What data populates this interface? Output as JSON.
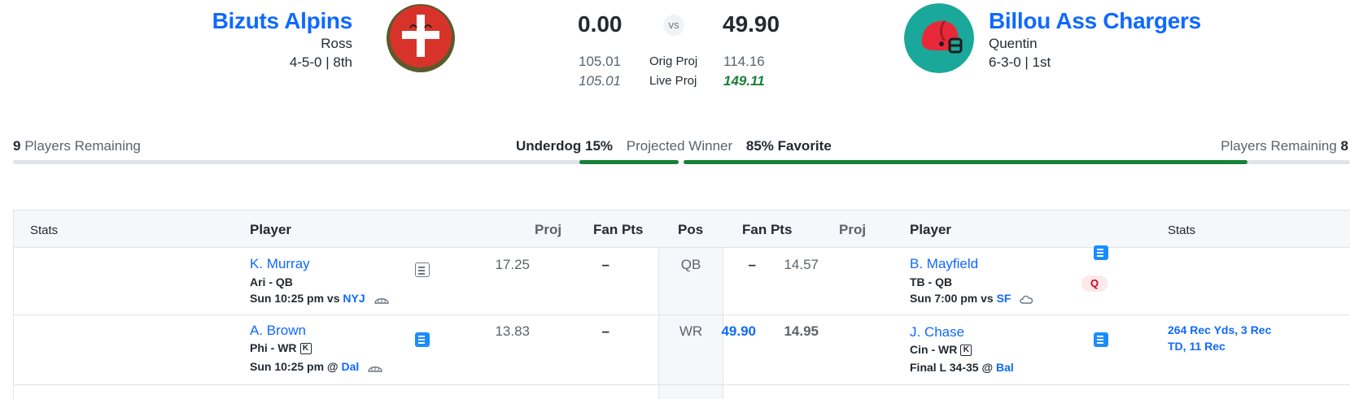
{
  "left_team": {
    "name": "Bizuts Alpins",
    "manager": "Ross",
    "record": "4-5-0 | 8th",
    "logo_icon": "swiss-flag-ball-icon",
    "score": "0.00",
    "orig_proj": "105.01",
    "live_proj": "105.01",
    "players_remaining_count": "9",
    "players_remaining_label": "Players Remaining"
  },
  "right_team": {
    "name": "Billou Ass Chargers",
    "manager": "Quentin",
    "record": "6-3-0 | 1st",
    "logo_icon": "football-helmet-icon",
    "score": "49.90",
    "orig_proj": "114.16",
    "live_proj": "149.11",
    "players_remaining_count": "8",
    "players_remaining_label": "Players Remaining"
  },
  "matchup": {
    "vs": "vs",
    "orig_proj_label": "Orig Proj",
    "live_proj_label": "Live Proj",
    "underdog_label": "Underdog 15%",
    "projected_winner_label": "Projected Winner",
    "favorite_label": "85% Favorite",
    "win_probability_left": 0.15,
    "win_probability_right": 0.85
  },
  "table": {
    "headers": {
      "stats_left": "Stats",
      "player_left": "Player",
      "proj_left": "Proj",
      "fanpts_left": "Fan Pts",
      "pos": "Pos",
      "fanpts_right": "Fan Pts",
      "proj_right": "Proj",
      "player_right": "Player",
      "stats_right": "Stats"
    },
    "rows": [
      {
        "pos": "QB",
        "left": {
          "name": "K. Murray",
          "team_pos": "Ari - QB",
          "game_prefix": "Sun 10:25 pm vs",
          "opponent": "NYJ",
          "weather_icon": "stadium-dome-icon",
          "note_icon": "notes-outline-icon",
          "proj": "17.25",
          "fan_pts": "–",
          "stats": ""
        },
        "right": {
          "name": "B. Mayfield",
          "team_pos": "TB - QB",
          "game_prefix": "Sun 7:00 pm vs",
          "opponent": "SF",
          "weather_icon": "cloud-icon",
          "note_icon": "notes-filled-icon",
          "status_badge": "Q",
          "proj": "14.57",
          "fan_pts": "–",
          "stats": ""
        }
      },
      {
        "pos": "WR",
        "left": {
          "name": "A. Brown",
          "team_pos": "Phi - WR",
          "badge": "K",
          "game_prefix": "Sun 10:25 pm @",
          "opponent": "Dal",
          "weather_icon": "stadium-dome-icon",
          "note_icon": "notes-filled-icon",
          "proj": "13.83",
          "fan_pts": "–",
          "stats": ""
        },
        "right": {
          "name": "J. Chase",
          "team_pos": "Cin - WR",
          "badge": "K",
          "game_prefix": "Final L 34-35 @",
          "opponent": "Bal",
          "note_icon": "notes-filled-icon",
          "proj": "14.95",
          "fan_pts": "49.90",
          "stats": "264 Rec Yds, 3 Rec TD, 11 Rec"
        }
      }
    ]
  },
  "colors": {
    "accent_blue": "#0f69ff",
    "favorite_green": "#188038",
    "questionable_red": "#d0021b"
  }
}
